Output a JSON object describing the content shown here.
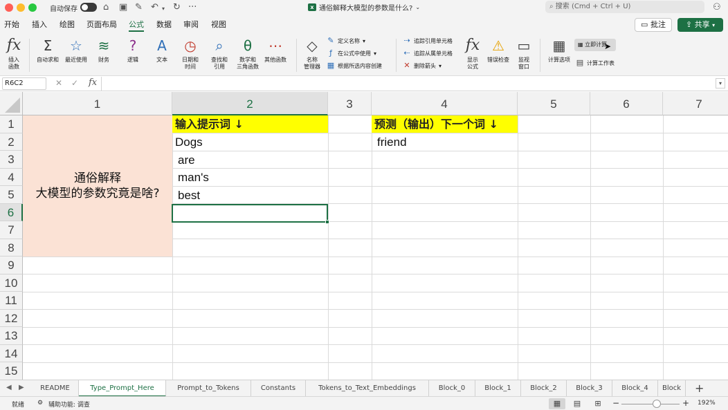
{
  "titlebar": {
    "autosave_label": "自动保存",
    "doc_title": "通俗解释大模型的参数是什么?",
    "search_placeholder": "搜索 (Cmd + Ctrl + U)"
  },
  "menu": {
    "tabs": [
      "开始",
      "插入",
      "绘图",
      "页面布局",
      "公式",
      "数据",
      "审阅",
      "视图"
    ],
    "active_tab": "公式",
    "comment_button": "批注",
    "share_button": "共享"
  },
  "ribbon": {
    "insert_function": "插入\n函数",
    "autosum": "自动求和",
    "recent": "最近使用",
    "financial": "财务",
    "logical": "逻辑",
    "text": "文本",
    "datetime": "日期和\n时间",
    "lookup": "查找和\n引用",
    "math": "数学和\n三角函数",
    "more": "其他函数",
    "name_manager": "名称\n管理器",
    "define_name": "定义名称",
    "use_in_formula": "在公式中使用",
    "create_from_selection": "根据所选内容创建",
    "trace_precedents": "追踪引用单元格",
    "trace_dependents": "追踪从属单元格",
    "remove_arrows": "删除箭头",
    "show_formulas": "显示\n公式",
    "error_checking": "错误检查",
    "watch_window": "监视\n窗口",
    "calc_options": "计算选项",
    "calc_now": "立即计算",
    "calc_sheet": "计算工作表"
  },
  "formula_bar": {
    "name_box": "R6C2",
    "fx": "fx",
    "value": ""
  },
  "grid": {
    "columns": [
      "1",
      "2",
      "3",
      "4",
      "5",
      "6",
      "7"
    ],
    "rows": [
      "1",
      "2",
      "3",
      "4",
      "5",
      "6",
      "7",
      "8",
      "9",
      "10",
      "11",
      "12",
      "13",
      "14",
      "15"
    ],
    "selected_column": "2",
    "selected_row": "6",
    "merged_text_line1": "通俗解释",
    "merged_text_line2": "大模型的参数究竟是啥?",
    "header_input": "输入提示词 ↓",
    "header_output": "预测（输出）下一个词 ↓",
    "inputs": [
      "Dogs",
      "are",
      "man's",
      "best"
    ],
    "output": "friend",
    "merged_fill": "#fbe2d5",
    "highlight_fill": "#ffff00"
  },
  "sheets": {
    "tabs": [
      "README",
      "Type_Prompt_Here",
      "Prompt_to_Tokens",
      "Constants",
      "Tokens_to_Text_Embeddings",
      "Block_0",
      "Block_1",
      "Block_2",
      "Block_3",
      "Block_4",
      "Block"
    ],
    "active": "Type_Prompt_Here"
  },
  "status": {
    "ready": "就绪",
    "accessibility": "辅助功能: 调查",
    "zoom": "192%"
  },
  "colors": {
    "accent": "#1d7044"
  }
}
